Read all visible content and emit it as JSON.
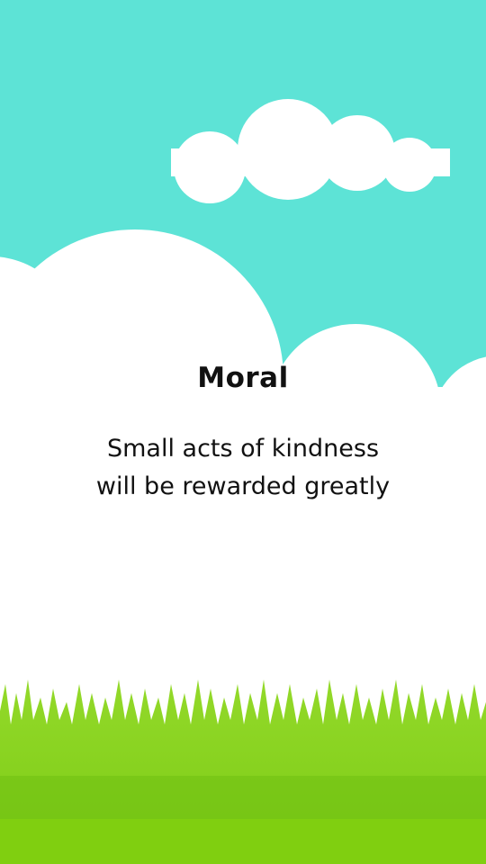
{
  "card": {
    "title": "Moral",
    "lines": [
      "Small acts of kindness",
      "will be rewarded greatly"
    ]
  },
  "colors": {
    "sky": "#5de3d6",
    "cloud": "#ffffff",
    "grass_light": "#8ad41e",
    "grass_dark": "#6fbf12",
    "text": "#111111"
  }
}
